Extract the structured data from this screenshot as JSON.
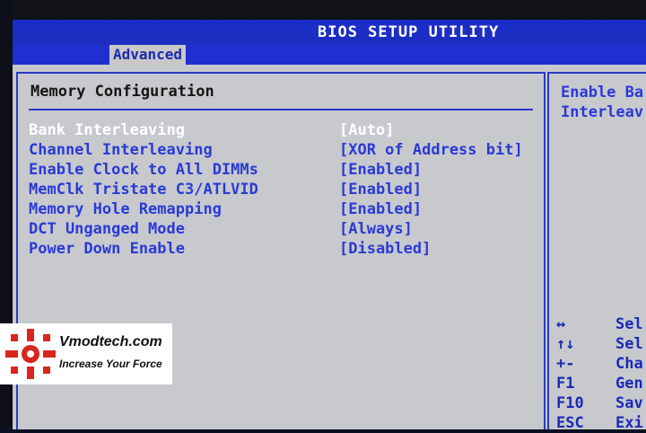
{
  "window": {
    "title": "BIOS SETUP UTILITY"
  },
  "tabs": [
    {
      "label": "Advanced",
      "active": true
    }
  ],
  "section": {
    "title": "Memory Configuration"
  },
  "settings": [
    {
      "label": "Bank Interleaving",
      "value": "[Auto]",
      "selected": true
    },
    {
      "label": "Channel Interleaving",
      "value": "[XOR of Address bit]"
    },
    {
      "label": "Enable Clock to All DIMMs",
      "value": "[Enabled]"
    },
    {
      "label": "MemClk Tristate C3/ATLVID",
      "value": "[Enabled]"
    },
    {
      "label": "Memory Hole Remapping",
      "value": "[Enabled]"
    },
    {
      "label": "DCT Unganged Mode",
      "value": "[Always]"
    },
    {
      "label": "Power Down Enable",
      "value": "[Disabled]"
    }
  ],
  "help": {
    "text": "Enable Ba\nInterleav"
  },
  "keys": [
    {
      "key": "↔",
      "desc": "Sel"
    },
    {
      "key": "↑↓",
      "desc": "Sel"
    },
    {
      "key": "+-",
      "desc": "Cha"
    },
    {
      "key": "F1",
      "desc": "Gen"
    },
    {
      "key": "F10",
      "desc": "Sav"
    },
    {
      "key": "ESC",
      "desc": "Exi"
    }
  ],
  "watermark": {
    "name": "Vmodtech.com",
    "tagline": "Increase Your Force"
  },
  "colors": {
    "header": "#1d2fbf",
    "panel": "#c7c9cd",
    "text": "#2a3ad6",
    "selected": "#ffffff"
  }
}
